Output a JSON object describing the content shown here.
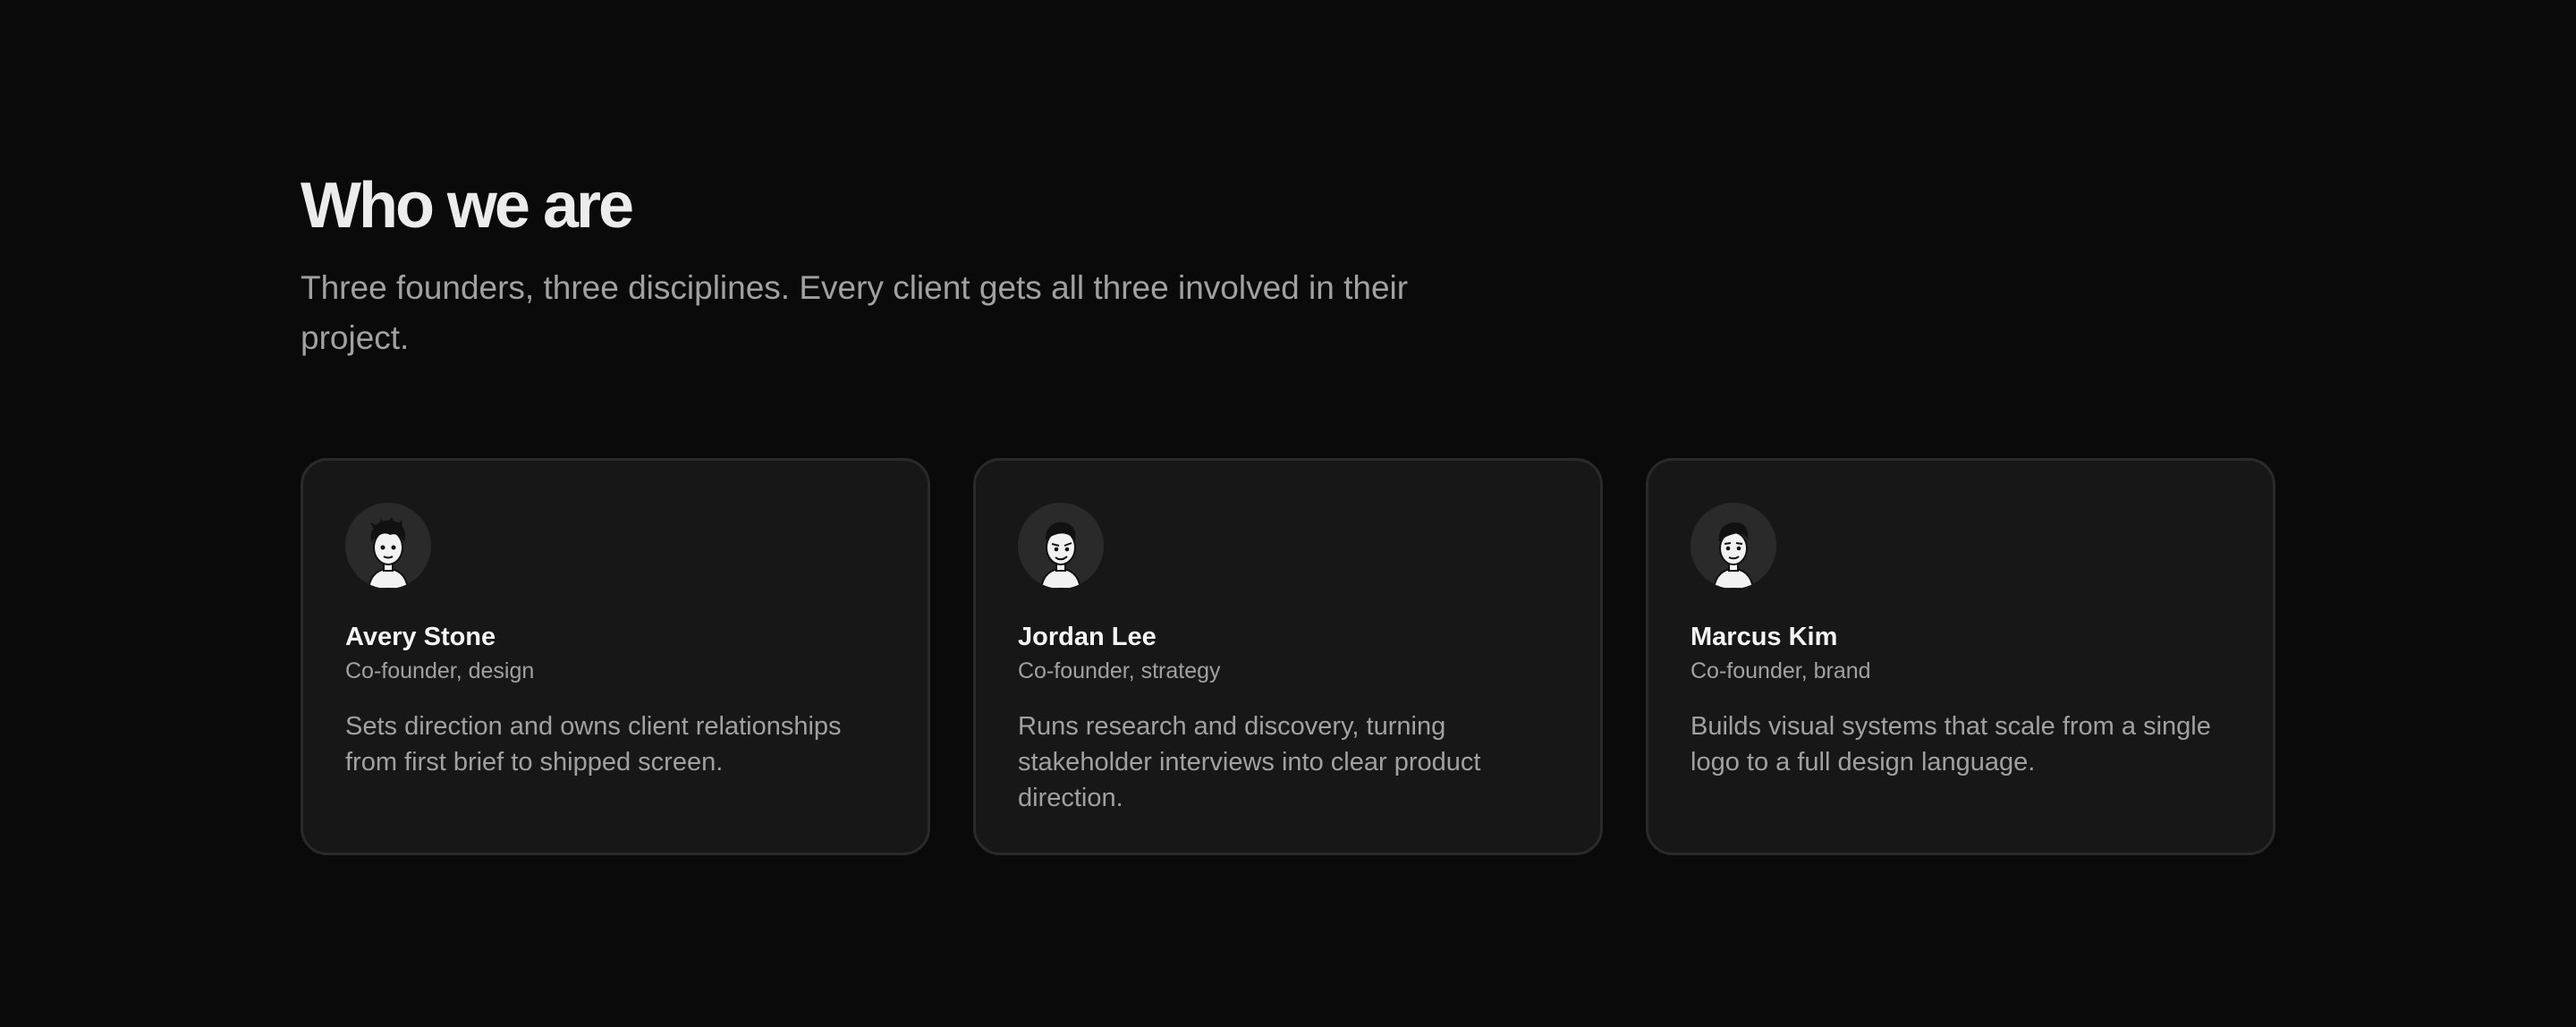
{
  "header": {
    "title": "Who we are",
    "subtitle": "Three founders, three disciplines. Every client gets all three involved in their project."
  },
  "founders": [
    {
      "name": "Avery Stone",
      "role": "Co-founder, design",
      "bio": "Sets direction and owns client relationships from first brief to shipped screen.",
      "avatar_icon": "avatar-illustration-icon"
    },
    {
      "name": "Jordan Lee",
      "role": "Co-founder, strategy",
      "bio": "Runs research and discovery, turning stakeholder interviews into clear product direction.",
      "avatar_icon": "avatar-illustration-icon"
    },
    {
      "name": "Marcus Kim",
      "role": "Co-founder, brand",
      "bio": "Builds visual systems that scale from a single logo to a full design language.",
      "avatar_icon": "avatar-illustration-icon"
    }
  ],
  "colors": {
    "background": "#0a0a0a",
    "card": "#171717",
    "card_border": "#2a2a2a",
    "text_primary": "#f5f5f5",
    "text_secondary": "#a1a1a1"
  }
}
